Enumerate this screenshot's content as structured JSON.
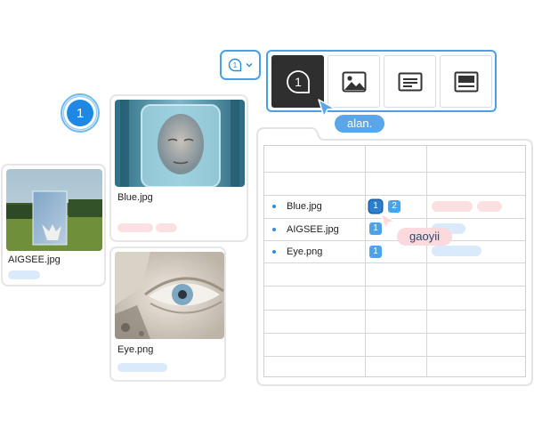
{
  "toolbar": {
    "dropdown_icon": "number-one-bubble-icon",
    "dropdown_value": "1",
    "buttons": [
      {
        "icon": "number-one-bubble-icon",
        "label": "1",
        "active": true
      },
      {
        "icon": "image-icon",
        "active": false
      },
      {
        "icon": "text-document-icon",
        "active": false
      },
      {
        "icon": "caption-layout-icon",
        "active": false
      }
    ]
  },
  "cursors": {
    "alan": {
      "name": "alan.",
      "color": "#5aa6e8"
    },
    "gaoyii": {
      "name": "gaoyii",
      "color": "#fbd9dc"
    }
  },
  "badge": {
    "value": "1"
  },
  "cards": [
    {
      "caption": "AIGSEE.jpg"
    },
    {
      "caption": "Blue.jpg"
    },
    {
      "caption": "Eye.png"
    }
  ],
  "table": {
    "rows": [
      {
        "name": "Blue.jpg",
        "numbers": [
          "1",
          "2"
        ]
      },
      {
        "name": "AIGSEE.jpg",
        "numbers": [
          "1"
        ]
      },
      {
        "name": "Eye.png",
        "numbers": [
          "1"
        ]
      }
    ]
  },
  "colors": {
    "accent": "#1e88e5",
    "border_blue": "#4aa0e6",
    "pill_pink": "#fbe0e2",
    "pill_blue": "#dbeafa"
  }
}
